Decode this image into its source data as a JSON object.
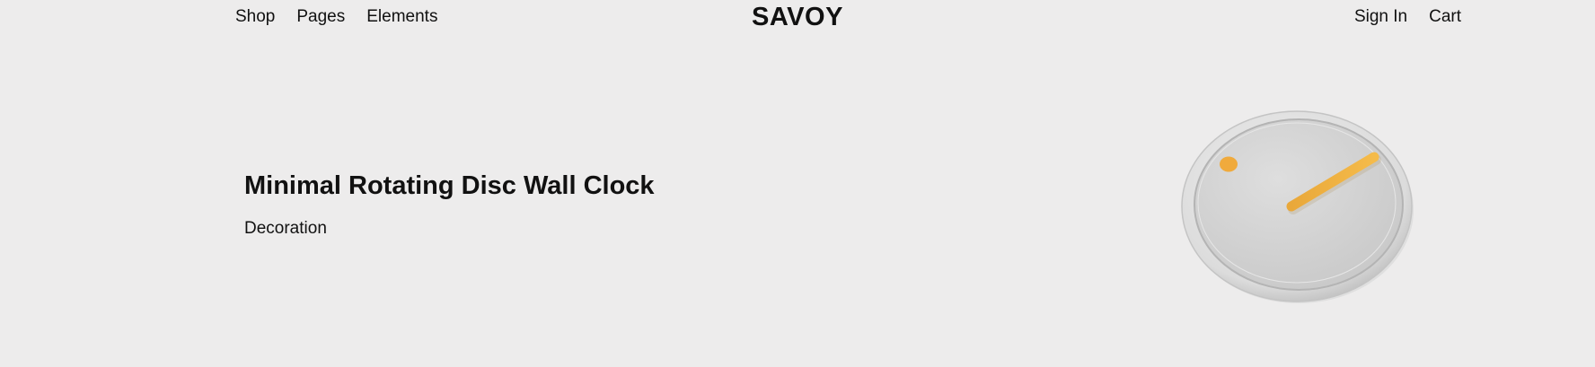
{
  "header": {
    "nav_left": [
      {
        "label": "Shop"
      },
      {
        "label": "Pages"
      },
      {
        "label": "Elements"
      }
    ],
    "logo": "SAVOY",
    "nav_right": [
      {
        "label": "Sign In"
      },
      {
        "label": "Cart"
      }
    ]
  },
  "product": {
    "title": "Minimal Rotating Disc Wall Clock",
    "category": "Decoration",
    "image_icon": "wall-clock-icon",
    "colors": {
      "background": "#edecec",
      "clock_body": "#d6d6d6",
      "accent": "#f0b03c"
    }
  }
}
